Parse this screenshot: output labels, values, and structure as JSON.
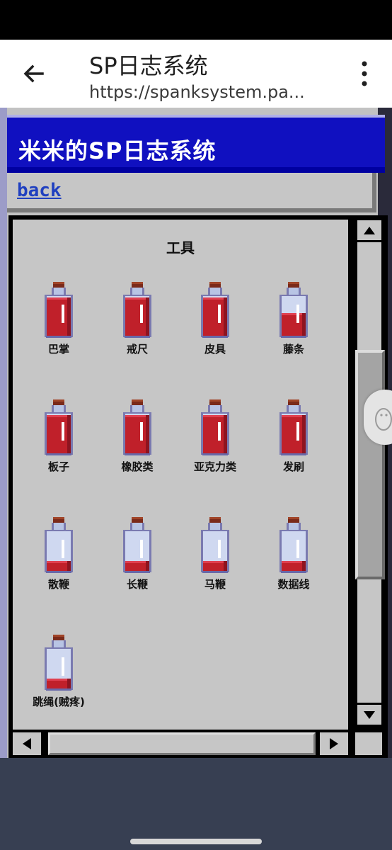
{
  "browser": {
    "title": "SP日志系统",
    "url": "https://spanksystem.pa...",
    "back_icon": "arrow-left-icon",
    "menu_icon": "more-vert-icon"
  },
  "page": {
    "header_title": "米米的SP日志系统",
    "back_link": "back",
    "section_title": "工具",
    "colors": {
      "header_blue": "#1010c0",
      "link_blue": "#2040c0",
      "panel_gray": "#c6c6c6",
      "potion_red": "#c0202a",
      "bottom_slate": "#373f52"
    }
  },
  "tools": [
    {
      "label": "巴掌",
      "fill": "full",
      "icon": "red-potion-icon"
    },
    {
      "label": "戒尺",
      "fill": "full",
      "icon": "red-potion-icon"
    },
    {
      "label": "皮具",
      "fill": "full",
      "icon": "red-potion-icon"
    },
    {
      "label": "藤条",
      "fill": "half",
      "icon": "half-potion-icon"
    },
    {
      "label": "板子",
      "fill": "full",
      "icon": "red-potion-icon"
    },
    {
      "label": "橡胶类",
      "fill": "full",
      "icon": "red-potion-icon"
    },
    {
      "label": "亚克力类",
      "fill": "full",
      "icon": "red-potion-icon"
    },
    {
      "label": "发刷",
      "fill": "full",
      "icon": "red-potion-icon"
    },
    {
      "label": "散鞭",
      "fill": "low",
      "icon": "low-potion-icon"
    },
    {
      "label": "长鞭",
      "fill": "low",
      "icon": "low-potion-icon"
    },
    {
      "label": "马鞭",
      "fill": "low",
      "icon": "low-potion-icon"
    },
    {
      "label": "数据线",
      "fill": "low",
      "icon": "low-potion-icon"
    },
    {
      "label": "跳绳(贼疼)",
      "fill": "low",
      "icon": "low-potion-icon"
    }
  ],
  "scrollbars": {
    "up_icon": "scroll-up-icon",
    "down_icon": "scroll-down-icon",
    "left_icon": "scroll-left-icon",
    "right_icon": "scroll-right-icon"
  }
}
